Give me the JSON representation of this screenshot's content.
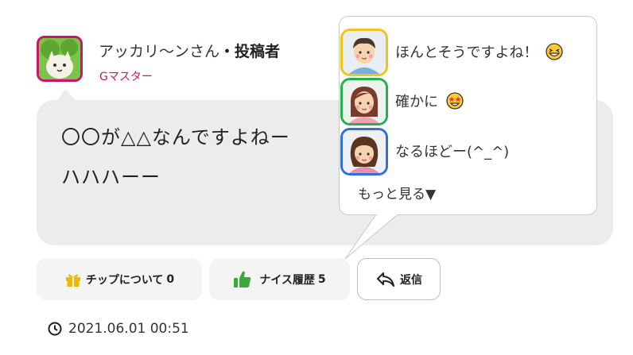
{
  "post": {
    "author_name": "アッカリ〜ンさん",
    "author_role": "・投稿者",
    "author_title": "Gマスター",
    "message_line1": "〇〇が△△なんですよねー",
    "message_line2": "ハハハーー",
    "timestamp": "2021.06.01 00:51"
  },
  "reactions": {
    "items": [
      {
        "text": "ほんとそうですよね！",
        "emoji": "laughing-emoji",
        "avatar": "man-avatar",
        "border_color": "#f0c419"
      },
      {
        "text": "確かに",
        "emoji": "star-struck-emoji",
        "avatar": "woman-avatar",
        "border_color": "#22b14c"
      },
      {
        "text": "なるほどー(^_^)",
        "emoji": "",
        "avatar": "girl-avatar",
        "border_color": "#2f6fde"
      }
    ],
    "more_label": "もっと見る▼"
  },
  "actions": {
    "tip_label": "チップについて",
    "tip_count": "0",
    "nice_label": "ナイス履歴",
    "nice_count": "5",
    "reply_label": "返信"
  },
  "colors": {
    "accent": "#c8176a",
    "bubble": "#eaedea",
    "thumb": "#3aa83a",
    "gift": "#f2b705"
  }
}
